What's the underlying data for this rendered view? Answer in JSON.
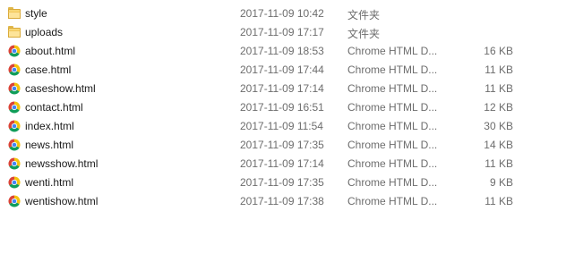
{
  "files": [
    {
      "name": "style",
      "date": "2017-11-09 10:42",
      "type": "文件夹",
      "size": "",
      "icon": "folder-icon"
    },
    {
      "name": "uploads",
      "date": "2017-11-09 17:17",
      "type": "文件夹",
      "size": "",
      "icon": "folder-icon"
    },
    {
      "name": "about.html",
      "date": "2017-11-09 18:53",
      "type": "Chrome HTML D...",
      "size": "16 KB",
      "icon": "chrome-icon"
    },
    {
      "name": "case.html",
      "date": "2017-11-09 17:44",
      "type": "Chrome HTML D...",
      "size": "11 KB",
      "icon": "chrome-icon"
    },
    {
      "name": "caseshow.html",
      "date": "2017-11-09 17:14",
      "type": "Chrome HTML D...",
      "size": "11 KB",
      "icon": "chrome-icon"
    },
    {
      "name": "contact.html",
      "date": "2017-11-09 16:51",
      "type": "Chrome HTML D...",
      "size": "12 KB",
      "icon": "chrome-icon"
    },
    {
      "name": "index.html",
      "date": "2017-11-09 11:54",
      "type": "Chrome HTML D...",
      "size": "30 KB",
      "icon": "chrome-icon"
    },
    {
      "name": "news.html",
      "date": "2017-11-09 17:35",
      "type": "Chrome HTML D...",
      "size": "14 KB",
      "icon": "chrome-icon"
    },
    {
      "name": "newsshow.html",
      "date": "2017-11-09 17:14",
      "type": "Chrome HTML D...",
      "size": "11 KB",
      "icon": "chrome-icon"
    },
    {
      "name": "wenti.html",
      "date": "2017-11-09 17:35",
      "type": "Chrome HTML D...",
      "size": "9 KB",
      "icon": "chrome-icon"
    },
    {
      "name": "wentishow.html",
      "date": "2017-11-09 17:38",
      "type": "Chrome HTML D...",
      "size": "11 KB",
      "icon": "chrome-icon"
    }
  ],
  "colors": {
    "folder": "#f8d775",
    "chrome_red": "#db4437",
    "chrome_yellow": "#f4c20d",
    "chrome_green": "#0f9d58",
    "chrome_blue": "#4285f4"
  }
}
